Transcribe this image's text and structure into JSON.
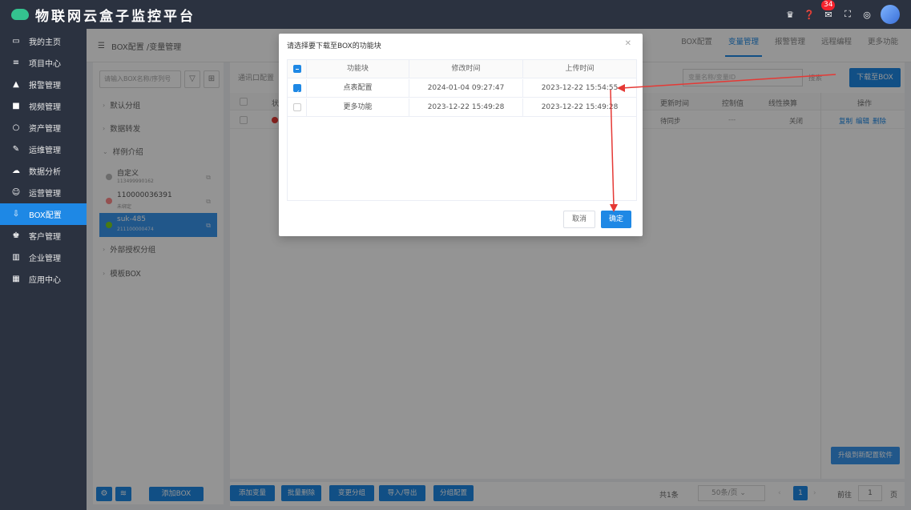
{
  "app": {
    "title": "物联网云盒子监控平台",
    "notification_count": "34"
  },
  "sidebar": {
    "items": [
      {
        "label": "我的主页",
        "icon": "monitor-icon",
        "glyph": "▭"
      },
      {
        "label": "项目中心",
        "icon": "list-icon",
        "glyph": "≡"
      },
      {
        "label": "报警管理",
        "icon": "bell-icon",
        "glyph": "▲"
      },
      {
        "label": "视频管理",
        "icon": "video-icon",
        "glyph": "■"
      },
      {
        "label": "资产管理",
        "icon": "asset-icon",
        "glyph": "○"
      },
      {
        "label": "运维管理",
        "icon": "wrench-icon",
        "glyph": "✎"
      },
      {
        "label": "数据分析",
        "icon": "cloud-icon",
        "glyph": "☁"
      },
      {
        "label": "运营管理",
        "icon": "people-icon",
        "glyph": "☺"
      },
      {
        "label": "BOX配置",
        "icon": "download-icon",
        "glyph": "⇩"
      },
      {
        "label": "客户管理",
        "icon": "customer-icon",
        "glyph": "♚"
      },
      {
        "label": "企业管理",
        "icon": "bar-chart-icon",
        "glyph": "▥"
      },
      {
        "label": "应用中心",
        "icon": "grid-icon",
        "glyph": "▦"
      }
    ],
    "active_index": 8
  },
  "breadcrumb": {
    "text": "BOX配置 /变量管理"
  },
  "tabs": [
    "BOX配置",
    "变量管理",
    "报警管理",
    "远程编程",
    "更多功能"
  ],
  "left_panel": {
    "search_placeholder": "请输入BOX名称/序列号",
    "groups": {
      "default": "默认分组",
      "forward": "数据转发",
      "sample": "样例介绍",
      "external": "外部授权分组",
      "template": "模板BOX"
    },
    "boxes": [
      {
        "name": "自定义",
        "serial": "113499990162",
        "status_color": "#bbbbbb"
      },
      {
        "name": "110000036391",
        "serial": "未绑定",
        "status_color": "#ff8a8a"
      },
      {
        "name": "suk-485",
        "serial": "211100000474",
        "status_color": "#7ed321"
      }
    ],
    "add_box_label": "添加BOX"
  },
  "main": {
    "tool_label": "通讯口配置",
    "search_placeholder": "变量名称/变量ID",
    "search_link": "搜索",
    "download_button": "下载至BOX",
    "columns": {
      "status": "状",
      "update_time": "更新时间",
      "control_value": "控制值",
      "linear": "线性换算",
      "ops": "操作"
    },
    "row": {
      "update_time": "待同步",
      "control_value": "---",
      "linear": "关闭",
      "ops": [
        "复制",
        "编辑",
        "删除"
      ]
    },
    "upgrade_button": "升级到新配置软件"
  },
  "bottom_bar": {
    "buttons": [
      "添加变量",
      "批量删除",
      "变更分组",
      "导入/导出",
      "分组配置"
    ],
    "total": "共1条",
    "page_size": "50条/页",
    "current_page": "1",
    "goto_label": "前往",
    "goto_value": "1",
    "page_suffix": "页"
  },
  "modal": {
    "title": "请选择要下载至BOX的功能块",
    "headers": [
      "功能块",
      "修改时间",
      "上传时间"
    ],
    "rows": [
      {
        "block": "点表配置",
        "modified": "2024-01-04 09:27:47",
        "uploaded": "2023-12-22 15:54:55",
        "checked": true
      },
      {
        "block": "更多功能",
        "modified": "2023-12-22 15:49:28",
        "uploaded": "2023-12-22 15:49:28",
        "checked": false
      }
    ],
    "cancel": "取消",
    "confirm": "确定"
  },
  "colors": {
    "primary": "#1e88e5",
    "sidebar_bg": "#2b3240",
    "annotation_arrow": "#e53935"
  }
}
